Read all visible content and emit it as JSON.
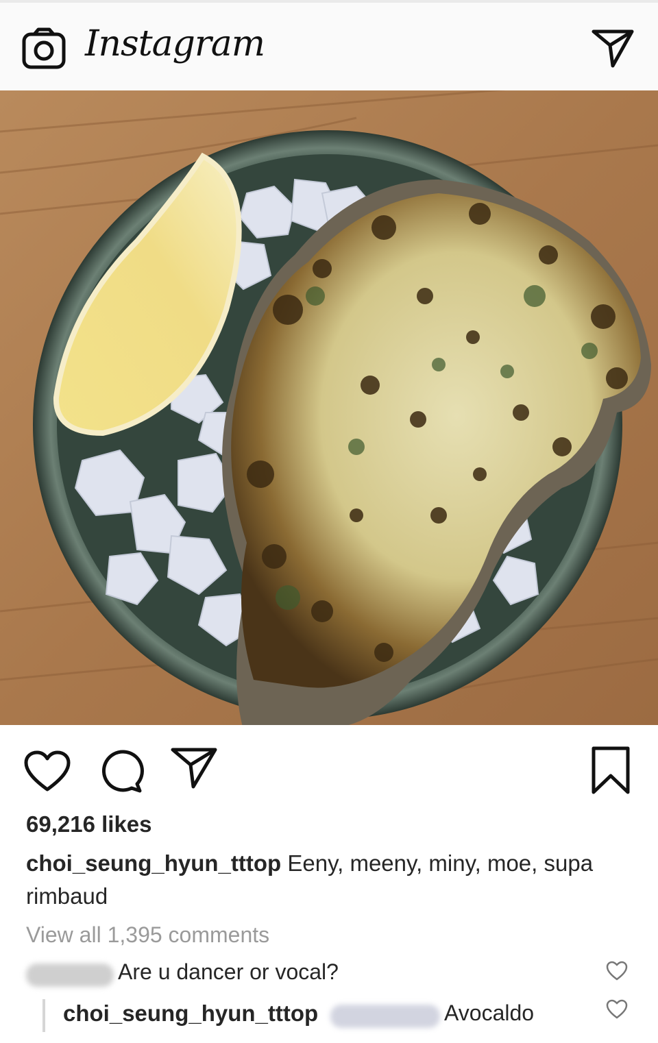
{
  "header": {
    "logo_text": "Instagram",
    "camera_icon": "camera-icon",
    "direct_icon": "paper-plane-icon"
  },
  "post": {
    "image_icon": "food-photo",
    "actions": {
      "like_icon": "heart-icon",
      "comment_icon": "comment-bubble-icon",
      "share_icon": "paper-plane-icon",
      "save_icon": "bookmark-icon"
    },
    "likes": "69,216 likes",
    "caption": {
      "username": "choi_seung_hyun_tttop",
      "text": "Eeny, meeny, miny, moe, supa rimbaud"
    },
    "view_all": "View all 1,395 comments",
    "comments": [
      {
        "text": "Are u dancer or vocal?"
      }
    ],
    "reply": {
      "username": "choi_seung_hyun_tttop",
      "text": "Avocaldo"
    }
  },
  "colors": {
    "text": "#262626",
    "muted": "#9a9a9a",
    "header_bg": "#fafafa"
  }
}
